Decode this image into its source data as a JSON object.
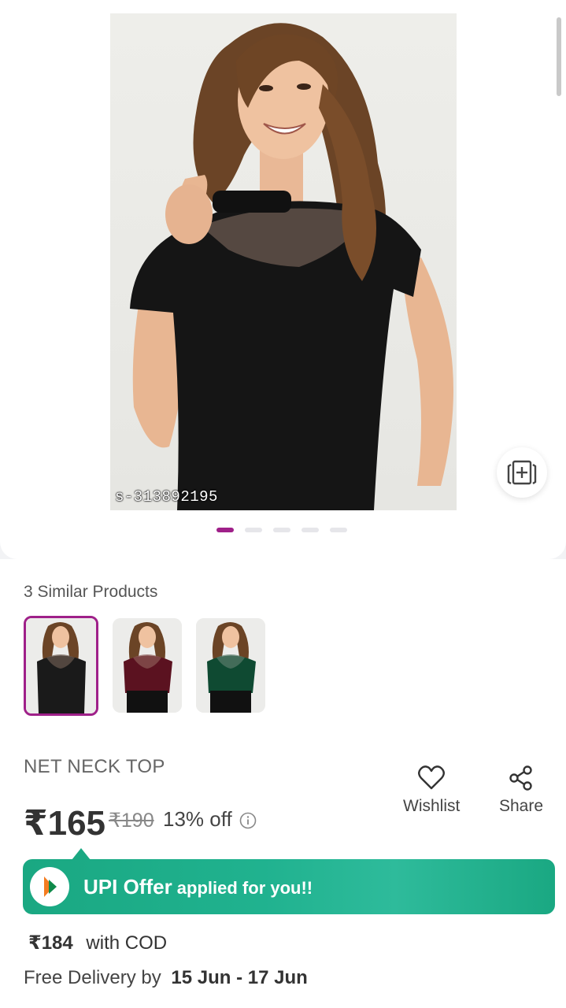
{
  "gallery": {
    "watermark": "s-313892195",
    "active_dot": 1,
    "dot_count": 5
  },
  "similar": {
    "title": "3 Similar Products",
    "items": [
      {
        "color": "#1a1a1a",
        "selected": true
      },
      {
        "color": "#5b1220",
        "selected": false
      },
      {
        "color": "#0f4a32",
        "selected": false
      }
    ]
  },
  "product": {
    "title": "NET NECK TOP",
    "price": "₹165",
    "mrp": "₹190",
    "discount": "13% off"
  },
  "actions": {
    "wishlist_label": "Wishlist",
    "share_label": "Share"
  },
  "upi": {
    "main": "UPI Offer",
    "sub": " applied for you!!"
  },
  "cod": {
    "price": "₹184",
    "label": "with COD"
  },
  "delivery": {
    "label": "Free Delivery by",
    "dates": "15 Jun - 17 Jun"
  },
  "colors": {
    "brand": "#9f2089",
    "upi_green": "#1aa882"
  }
}
